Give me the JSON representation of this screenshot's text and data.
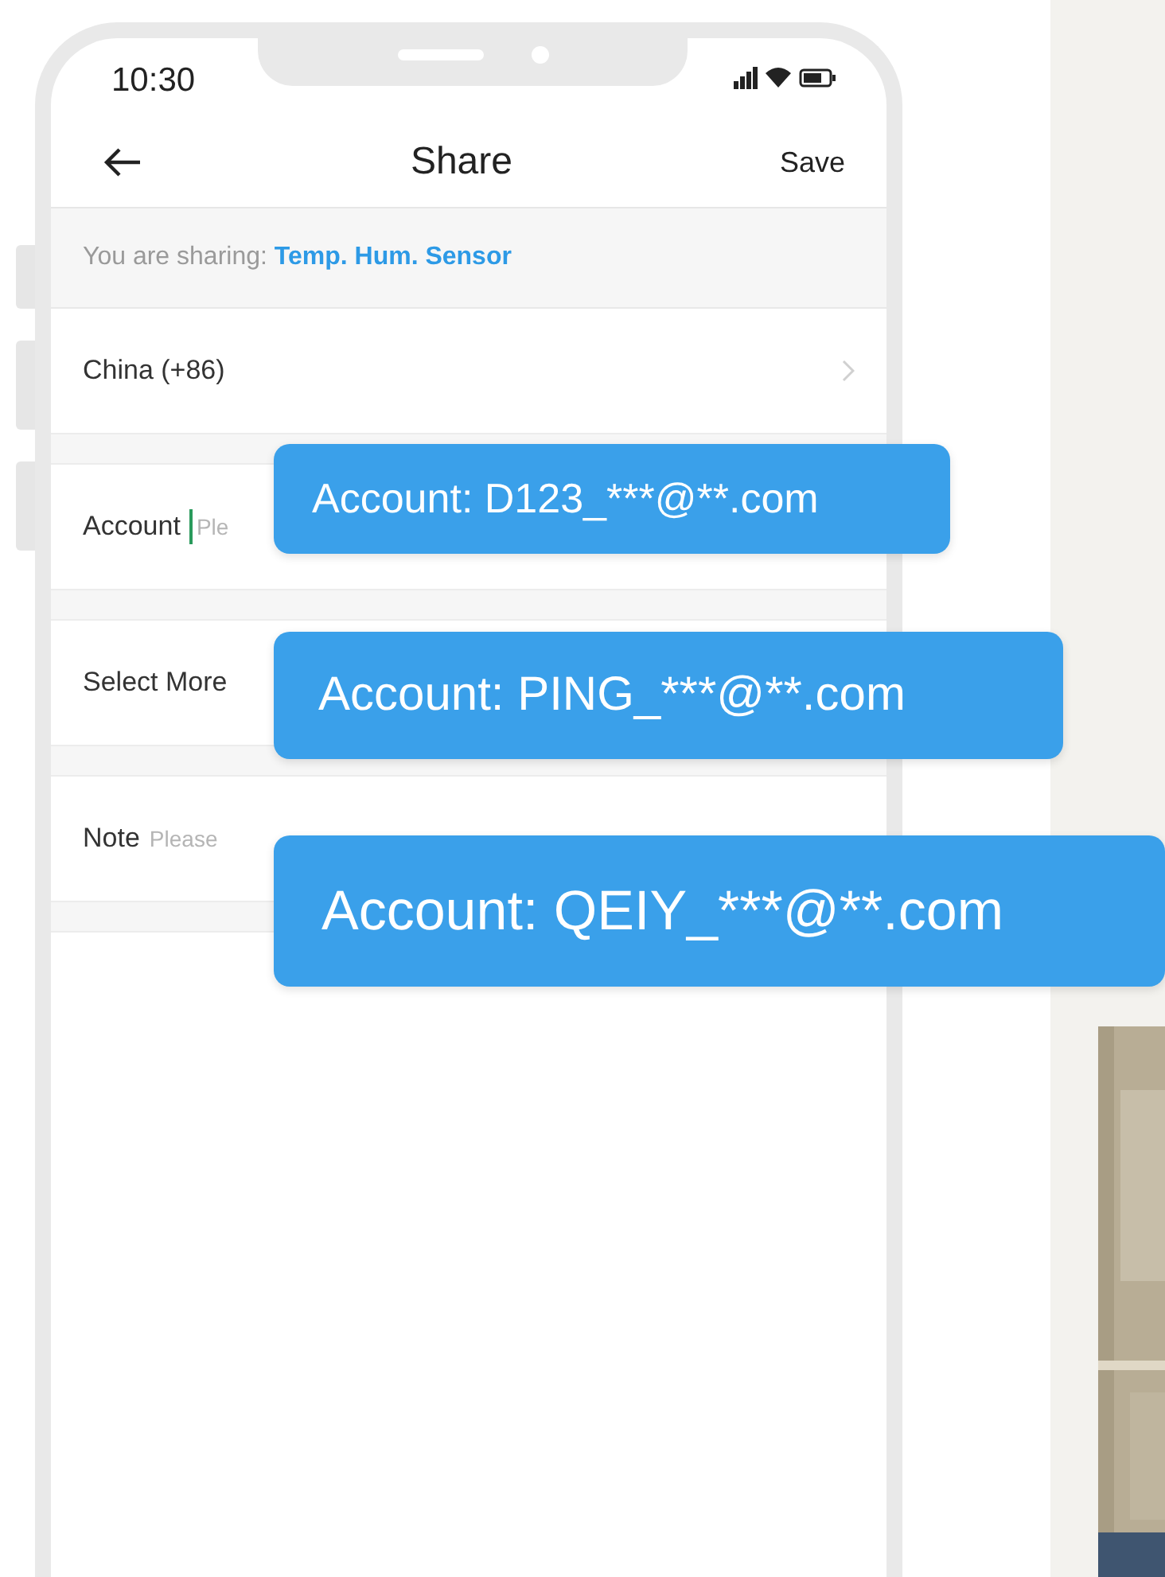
{
  "status_bar": {
    "time": "10:30"
  },
  "header": {
    "title": "Share",
    "action": "Save"
  },
  "sharing": {
    "label": "You are sharing:",
    "device": "Temp. Hum. Sensor"
  },
  "rows": [
    {
      "kind": "link",
      "label": "China (+86)"
    },
    {
      "kind": "input",
      "label": "Account",
      "placeholder": "Ple",
      "focused": true
    },
    {
      "kind": "plain",
      "label": "Select More"
    },
    {
      "kind": "input",
      "label": "Note",
      "placeholder": "Please",
      "focused": false
    }
  ],
  "bubbles": [
    "Account: D123_***@**.com",
    "Account: PING_***@**.com",
    "Account: QEIY_***@**.com"
  ],
  "background": {
    "kind": "picture"
  }
}
